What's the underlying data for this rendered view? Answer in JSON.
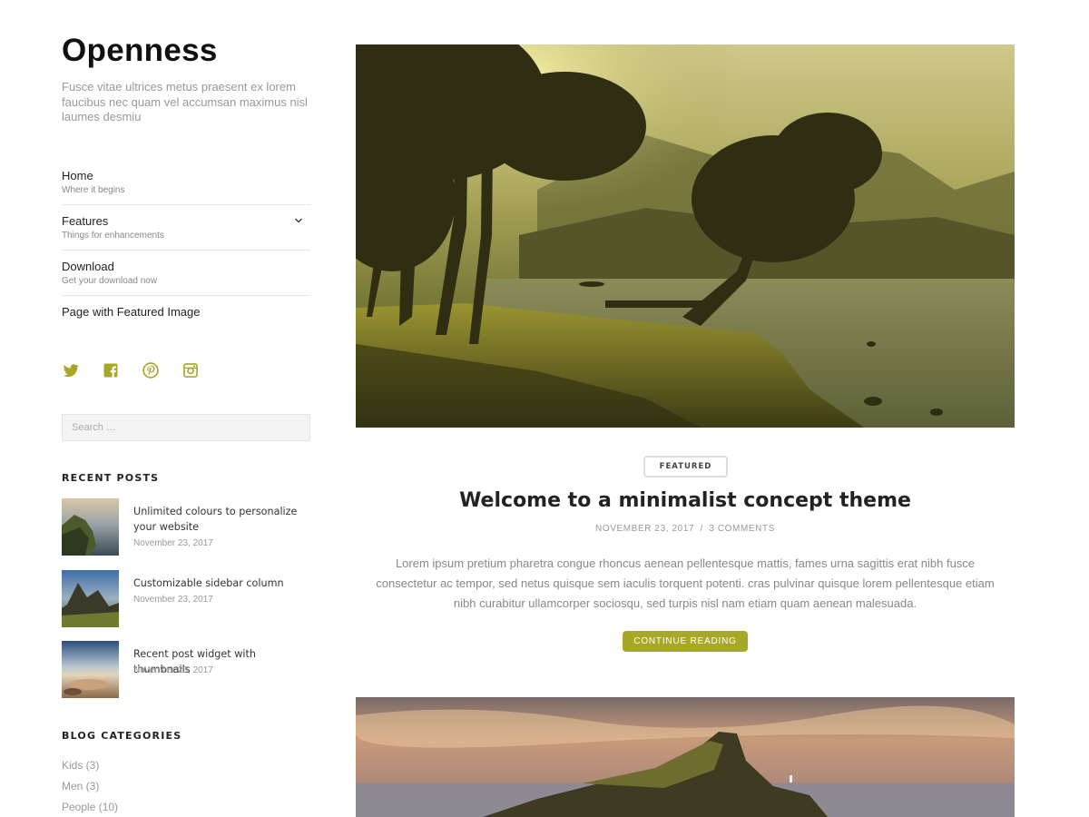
{
  "site": {
    "title": "Openness",
    "description": "Fusce vitae ultrices metus praesent ex lorem faucibus nec quam vel accumsan maximus nisl laumes desmiu"
  },
  "menu": [
    {
      "label": "Home",
      "sub": "Where it begins"
    },
    {
      "label": "Features",
      "sub": "Things for enhancements"
    },
    {
      "label": "Download",
      "sub": "Get your download now"
    },
    {
      "label": "Page with Featured Image",
      "sub": ""
    }
  ],
  "social": [
    "twitter-icon",
    "facebook-icon",
    "pinterest-icon",
    "instagram-icon"
  ],
  "search": {
    "placeholder": "Search …"
  },
  "recent_posts": {
    "title": "Recent Posts",
    "items": [
      {
        "title": "Unlimited colours to personalize your website",
        "date": "November 23, 2017"
      },
      {
        "title": "Customizable sidebar column",
        "date": "November 23, 2017"
      },
      {
        "title": "Recent post widget with thumbnails",
        "date": "November 23, 2017"
      }
    ]
  },
  "categories": {
    "title": "Blog Categories",
    "items": [
      "Kids (3)",
      "Men (3)",
      "People (10)"
    ]
  },
  "post": {
    "badge": "Featured",
    "title": "Welcome to a minimalist concept theme",
    "date": "November 23, 2017",
    "separator": "/",
    "comments": "3 Comments",
    "excerpt": "Lorem ipsum pretium pharetra congue rhoncus aenean pellentesque mattis, fames urna sagittis erat nibh fusce consectetur ac tempor, sed netus quisque sem iaculis torquent potenti. cras pulvinar quisque lorem pellentesque etiam nibh curabitur ullamcorper sociosqu, sed turpis nisl nam etiam quam aenean malesuada.",
    "button": "Continue Reading"
  },
  "colors": {
    "accent": "#a8a828",
    "text": "#333333",
    "muted": "#999999"
  }
}
